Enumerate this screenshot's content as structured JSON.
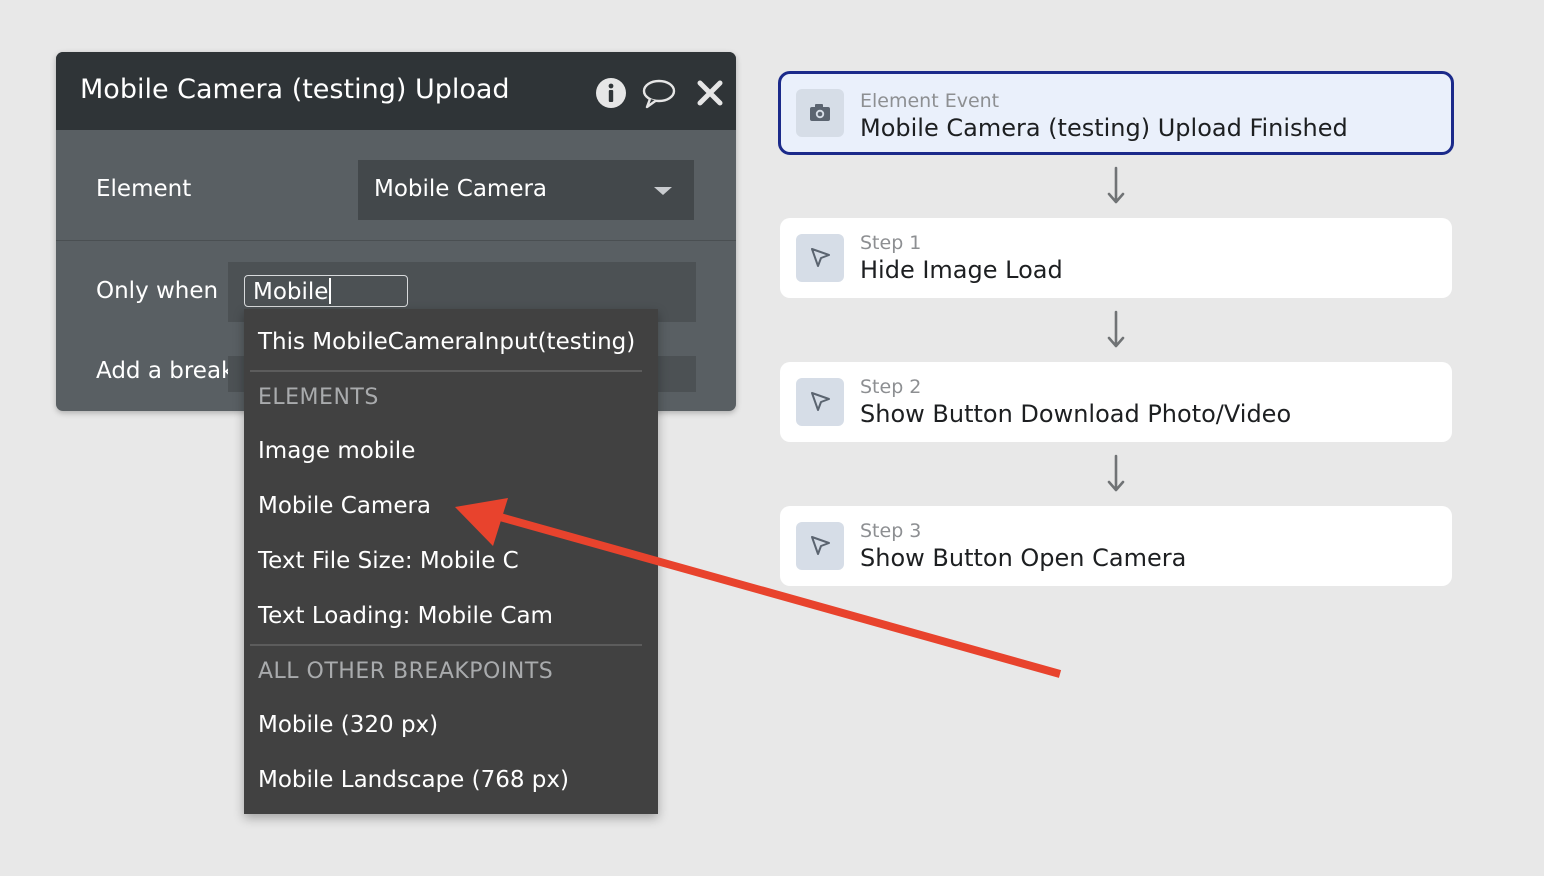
{
  "panel": {
    "title": "Mobile Camera (testing) Upload",
    "header_icons": [
      "info-icon",
      "comment-icon",
      "close-icon"
    ],
    "element_label": "Element",
    "element_value": "Mobile Camera",
    "only_when_label": "Only when",
    "only_when_value": "Mobile",
    "breakpoint_label": "Add a breakp"
  },
  "dropdown": {
    "top_item": "This MobileCameraInput(testing)",
    "elements_header": "ELEMENTS",
    "elements": [
      "Image mobile",
      "Mobile Camera",
      "Text File Size: Mobile C",
      "Text Loading: Mobile Cam"
    ],
    "breakpoints_header": "ALL OTHER BREAKPOINTS",
    "breakpoints": [
      "Mobile (320 px)",
      "Mobile Landscape (768 px)"
    ]
  },
  "workflow": {
    "event": {
      "kicker": "Element Event",
      "name": "Mobile Camera (testing) Upload Finished",
      "icon": "camera-icon"
    },
    "steps": [
      {
        "kicker": "Step 1",
        "name": "Hide Image Load",
        "icon": "cursor-icon"
      },
      {
        "kicker": "Step 2",
        "name": "Show Button Download Photo/Video",
        "icon": "cursor-icon"
      },
      {
        "kicker": "Step 3",
        "name": "Show Button Open Camera",
        "icon": "cursor-icon"
      }
    ]
  },
  "colors": {
    "panel_bg": "#595f63",
    "panel_header": "#2f3437",
    "dropdown_bg": "#414141",
    "event_border": "#1b2a8a",
    "event_bg": "#eaf0fb",
    "annotation_arrow": "#e8432d",
    "canvas_bg": "#e8e8e8"
  }
}
